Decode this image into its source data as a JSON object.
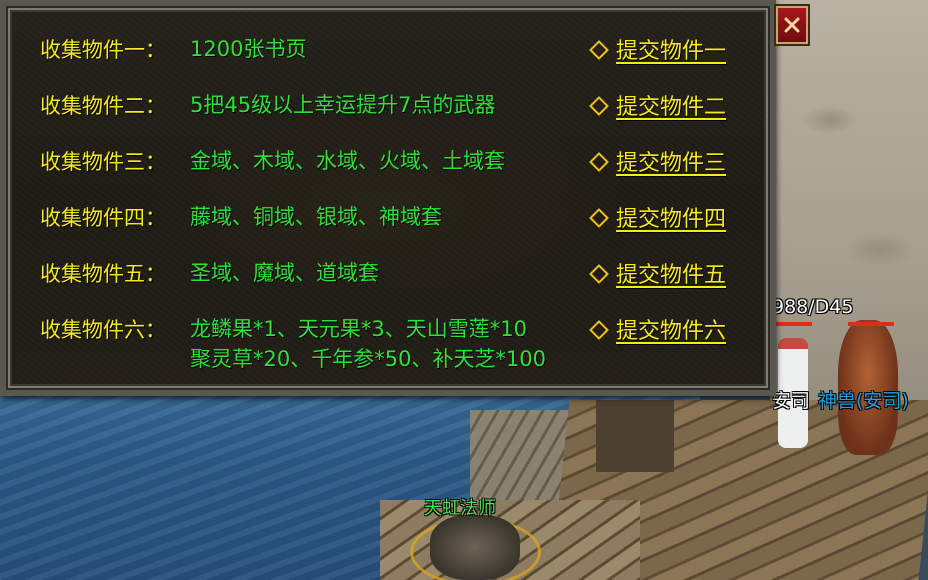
{
  "dialog": {
    "items": [
      {
        "label": "收集物件一：",
        "lines": [
          "1200张书页"
        ],
        "submit": "提交物件一"
      },
      {
        "label": "收集物件二：",
        "lines": [
          "5把45级以上幸运提升7点的武器"
        ],
        "submit": "提交物件二"
      },
      {
        "label": "收集物件三：",
        "lines": [
          "金域、木域、水域、火域、土域套"
        ],
        "submit": "提交物件三"
      },
      {
        "label": "收集物件四：",
        "lines": [
          "藤域、铜域、银域、神域套"
        ],
        "submit": "提交物件四"
      },
      {
        "label": "收集物件五：",
        "lines": [
          "圣域、魔域、道域套"
        ],
        "submit": "提交物件五"
      },
      {
        "label": "收集物件六：",
        "lines": [
          "龙鳞果*1、天元果*3、天山雪莲*10",
          "聚灵草*20、千年参*50、补天芝*100"
        ],
        "submit": "提交物件六"
      }
    ],
    "close_icon": "close-x-icon",
    "submit_icon": "diamond-bullet-icon"
  },
  "world": {
    "pet_level_text": "988/D45",
    "npc_name": "安司",
    "pet_name": "神兽(安司)",
    "mage_name": "天虹法师"
  },
  "colors": {
    "label": "#f7ea1e",
    "value": "#2fe03a",
    "link": "#f7ea1e",
    "pet_name": "#1fa0e8",
    "mage_name": "#4fe25a"
  }
}
